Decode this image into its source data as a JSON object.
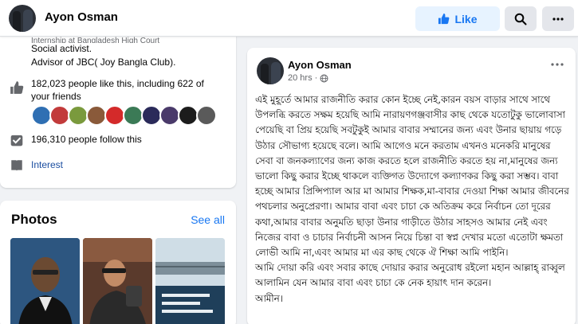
{
  "header": {
    "page_name": "Ayon Osman",
    "like_label": "Like",
    "search_icon": "search-icon",
    "more_icon": "more-horizontal-icon"
  },
  "intro": {
    "cut_line": "Internship at Bangladesh High Court",
    "line1": "Social activist.",
    "line2": "Advisor of JBC( Joy Bangla Club).",
    "likes": "182,023 people like this, including 622 of your friends",
    "follows": "196,310 people follow this",
    "interest": "Interest",
    "friend_colors": [
      "#2f6fb3",
      "#c23b3b",
      "#7a9a3d",
      "#8a5a3a",
      "#d42a2a",
      "#3b7a56",
      "#2a2a5a",
      "#4a3a6a",
      "#1c1c1c",
      "#5a5a5a"
    ]
  },
  "photos": {
    "title": "Photos",
    "see_all": "See all"
  },
  "post": {
    "author": "Ayon Osman",
    "time": "20 hrs",
    "audience_icon": "globe-icon",
    "paragraphs": [
      "এই মুহূর্তে আমার রাজনীতি করার কোন ইচ্ছে নেই,কারন বয়স বাড়ার সাথে সাথে উপলব্ধি করতে সক্ষম হয়েছি আমি নারায়ণগঞ্জবাসীর কাছ থেকে যতোটুকু ভালোবাসা পেয়েছি বা প্রিয় হয়েছি সবটুকুই আমার বাবার সম্মানের জন্য এবং উনার ছায়ায় গড়ে উঠার সৌভাগ্য হয়েছে বলে। আমি আগেও মনে করতাম এখনও মনেকরি মানুষের সেবা বা জনকল্যাণের জন্য কাজ করতে হলে রাজনীতি করতে হয় না,মানুষের জন্য ভালো কিছু করার ইচ্ছে থাকলে ব্যক্তিগত উদ্যোগে কল্যাণকর কিছু করা সম্ভব। বাবা হচ্ছে আমার প্রিন্সিপ্যাল আর মা আমার শিক্ষক,মা-বাবার দেওয়া শিক্ষা আমার জীবনের পথচলার অনুপ্রেরণা। আমার বাবা এবং চাচা কে অতিক্রম করে নির্বাচন তো দূরের কথা,আমার বাবার অনুমতি ছাড়া উনার গাড়ীতে উঠার সাহসও আমার নেই এবং নিজের বাবা ও চাচার নির্বাচনী আসন নিয়ে চিন্তা বা স্বপ্ন দেখার মতো এতোটা ক্ষমতা লোভী আমি না,এবং আমার মা এর কাছ থেকে ঐ শিক্ষা আমি পাইনি।",
      "আমি দোয়া করি এবং সবার কাছে দোয়ার করার অনুরোধ রইলো মহান আল্লাহ্‌ রাব্বুল আলামিন যেন আমার বাবা এবং চাচা কে নেক হায়াৎ দান করেন।",
      "আমীন।"
    ]
  },
  "colors": {
    "accent": "#1877f2",
    "like_bg": "#e7f3ff",
    "page_bg": "#f0f2f5"
  }
}
